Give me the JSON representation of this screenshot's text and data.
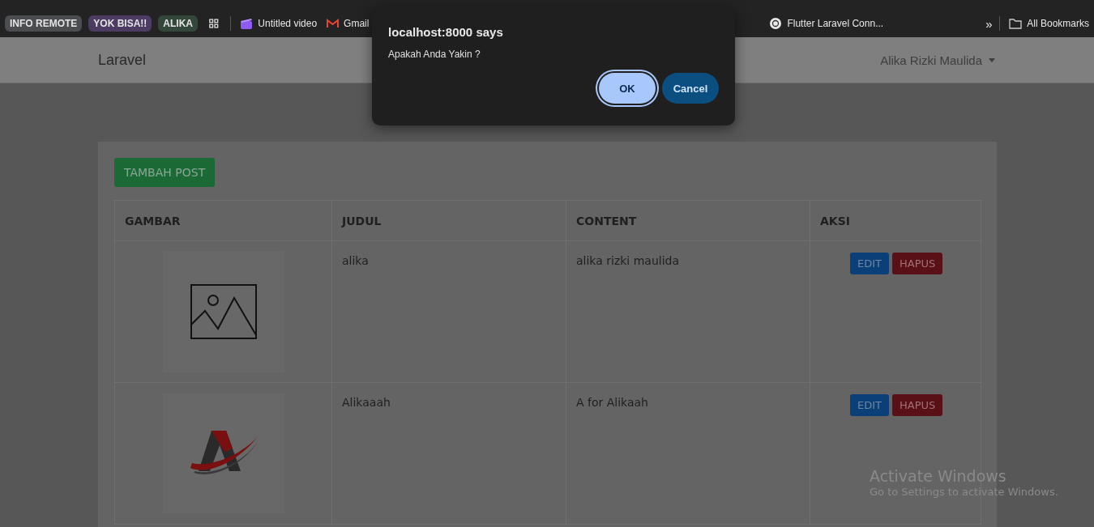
{
  "bookmarks_bar": {
    "items": [
      {
        "kind": "chip",
        "label": "INFO REMOTE",
        "color": "#4b4d50"
      },
      {
        "kind": "chip",
        "label": "YOK BISA!!",
        "color": "#4c3b63"
      },
      {
        "kind": "chip",
        "label": "ALIKA",
        "color": "#34473b"
      },
      {
        "kind": "apps"
      },
      {
        "kind": "video",
        "label": "Untitled video"
      },
      {
        "kind": "mail",
        "label": "Gmail"
      },
      {
        "kind": "site",
        "label": "Flutter Laravel Conn..."
      }
    ],
    "overflow": "»",
    "all_bookmarks": "All Bookmarks"
  },
  "navbar": {
    "brand": "Laravel",
    "user": "Alika Rizki Maulida"
  },
  "card": {
    "add_button": "TAMBAH POST",
    "table": {
      "columns": [
        "GAMBAR",
        "JUDUL",
        "CONTENT",
        "AKSI"
      ],
      "rows": [
        {
          "kind": "placeholder",
          "title": "alika",
          "content": "alika rizki maulida",
          "actions": [
            "EDIT",
            "HAPUS"
          ]
        },
        {
          "kind": "logo",
          "title": "Alikaaah",
          "content": "A for Alikaah",
          "actions": [
            "EDIT",
            "HAPUS"
          ]
        }
      ]
    }
  },
  "dialog": {
    "title": "localhost:8000 says",
    "message": "Apakah Anda Yakin ?",
    "buttons": [
      {
        "label": "OK",
        "focused": true
      },
      {
        "label": "Cancel",
        "focused": false
      }
    ]
  },
  "os_notice": {
    "title": "Activate Windows",
    "message": "Go to Settings to activate Windows."
  }
}
